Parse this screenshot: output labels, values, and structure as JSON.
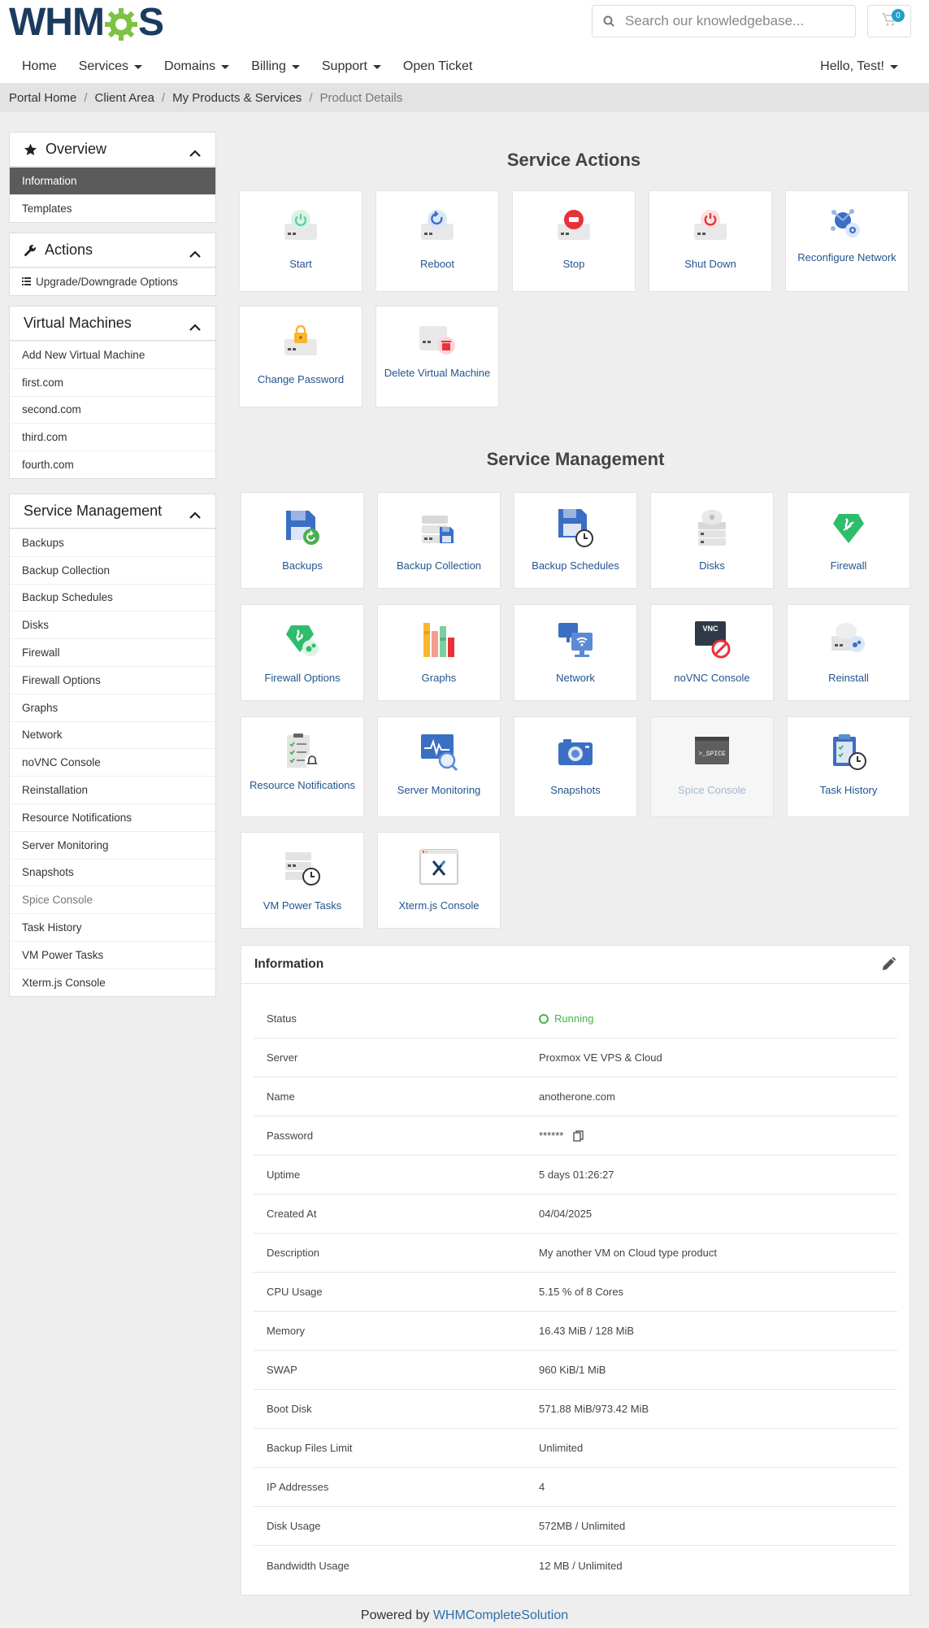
{
  "brand": {
    "logo_pre": "WHM",
    "logo_post": "S"
  },
  "search": {
    "placeholder": "Search our knowledgebase..."
  },
  "cart": {
    "count": "0"
  },
  "nav": {
    "items": [
      {
        "label": "Home"
      },
      {
        "label": "Services",
        "dropdown": true
      },
      {
        "label": "Domains",
        "dropdown": true
      },
      {
        "label": "Billing",
        "dropdown": true
      },
      {
        "label": "Support",
        "dropdown": true
      },
      {
        "label": "Open Ticket"
      }
    ],
    "user": "Hello, Test!"
  },
  "breadcrumb": [
    "Portal Home",
    "Client Area",
    "My Products & Services",
    "Product Details"
  ],
  "sidebar": {
    "overview": {
      "title": "Overview",
      "items": [
        "Information",
        "Templates"
      ]
    },
    "actions": {
      "title": "Actions",
      "items": [
        "Upgrade/Downgrade Options"
      ]
    },
    "vms": {
      "title": "Virtual Machines",
      "items": [
        "Add New Virtual Machine",
        "first.com",
        "second.com",
        "third.com",
        "fourth.com"
      ]
    },
    "management": {
      "title": "Service Management",
      "items": [
        "Backups",
        "Backup Collection",
        "Backup Schedules",
        "Disks",
        "Firewall",
        "Firewall Options",
        "Graphs",
        "Network",
        "noVNC Console",
        "Reinstallation",
        "Resource Notifications",
        "Server Monitoring",
        "Snapshots",
        "Spice Console",
        "Task History",
        "VM Power Tasks",
        "Xterm.js Console"
      ]
    }
  },
  "service_actions": {
    "title": "Service Actions",
    "tiles": [
      {
        "label": "Start",
        "icon": "server-start-icon"
      },
      {
        "label": "Reboot",
        "icon": "server-reboot-icon"
      },
      {
        "label": "Stop",
        "icon": "server-stop-icon"
      },
      {
        "label": "Shut Down",
        "icon": "server-shutdown-icon"
      },
      {
        "label": "Reconfigure Network",
        "icon": "network-gear-icon"
      },
      {
        "label": "Change Password",
        "icon": "server-lock-icon"
      },
      {
        "label": "Delete Virtual Machine",
        "icon": "server-delete-icon"
      }
    ]
  },
  "service_management": {
    "title": "Service Management",
    "tiles": [
      {
        "label": "Backups",
        "icon": "floppy-restore-icon"
      },
      {
        "label": "Backup Collection",
        "icon": "server-floppy-icon"
      },
      {
        "label": "Backup Schedules",
        "icon": "floppy-clock-icon"
      },
      {
        "label": "Disks",
        "icon": "disks-icon"
      },
      {
        "label": "Firewall",
        "icon": "firewall-icon"
      },
      {
        "label": "Firewall Options",
        "icon": "firewall-options-icon"
      },
      {
        "label": "Graphs",
        "icon": "graphs-icon"
      },
      {
        "label": "Network",
        "icon": "network-monitor-icon"
      },
      {
        "label": "noVNC Console",
        "icon": "vnc-console-icon",
        "icon_text": "VNC"
      },
      {
        "label": "Reinstall",
        "icon": "reinstall-icon"
      },
      {
        "label": "Resource Notifications",
        "icon": "notifications-clipboard-icon"
      },
      {
        "label": "Server Monitoring",
        "icon": "monitoring-icon"
      },
      {
        "label": "Snapshots",
        "icon": "camera-icon"
      },
      {
        "label": "Spice Console",
        "icon": "spice-console-icon",
        "icon_text": ">_SPICE",
        "disabled": true
      },
      {
        "label": "Task History",
        "icon": "task-history-icon"
      },
      {
        "label": "VM Power Tasks",
        "icon": "server-clock-icon"
      },
      {
        "label": "Xterm.js Console",
        "icon": "xterm-icon"
      }
    ]
  },
  "information": {
    "title": "Information",
    "rows": [
      {
        "key": "Status",
        "value": "Running",
        "status": "green"
      },
      {
        "key": "Server",
        "value": "Proxmox VE VPS & Cloud"
      },
      {
        "key": "Name",
        "value": "anotherone.com"
      },
      {
        "key": "Password",
        "value": "******",
        "copy": true
      },
      {
        "key": "Uptime",
        "value": "5 days 01:26:27"
      },
      {
        "key": "Created At",
        "value": "04/04/2025"
      },
      {
        "key": "Description",
        "value": "My another VM on Cloud type product"
      },
      {
        "key": "CPU Usage",
        "value": "5.15 % of 8 Cores"
      },
      {
        "key": "Memory",
        "value": "16.43 MiB / 128 MiB"
      },
      {
        "key": "SWAP",
        "value": "960 KiB/1 MiB"
      },
      {
        "key": "Boot Disk",
        "value": "571.88 MiB/973.42 MiB"
      },
      {
        "key": "Backup Files Limit",
        "value": "Unlimited"
      },
      {
        "key": "IP Addresses",
        "value": "4"
      },
      {
        "key": "Disk Usage",
        "value": "572MB / Unlimited"
      },
      {
        "key": "Bandwidth Usage",
        "value": "12 MB / Unlimited"
      }
    ]
  },
  "footer": {
    "prefix": "Powered by ",
    "link": "WHMCompleteSolution"
  },
  "colors": {
    "accent": "#2f6dab",
    "active": "#5b5b5b",
    "running": "#4caf50",
    "badge": "#20a0c4"
  }
}
